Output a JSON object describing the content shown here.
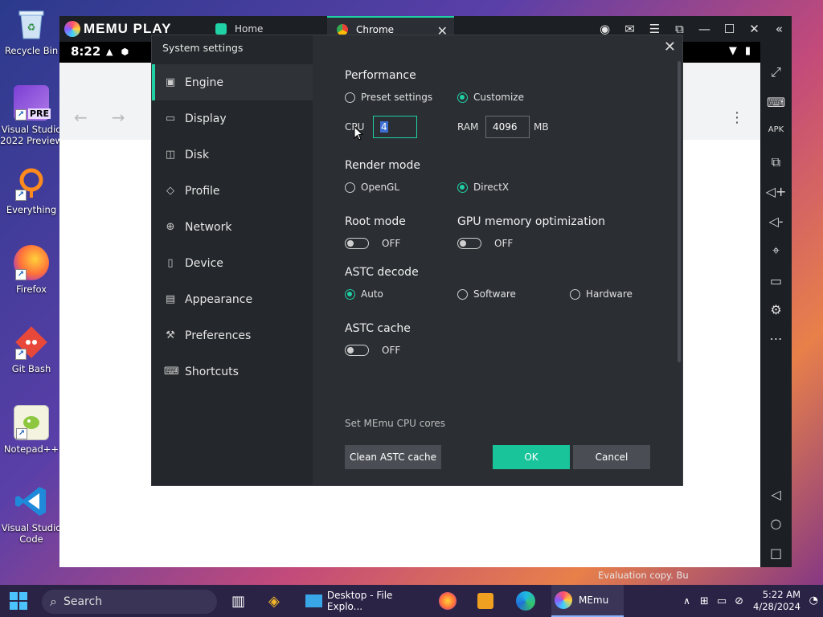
{
  "desktop": {
    "icons": [
      {
        "label": "Recycle Bin",
        "icon": "recycle-bin-icon"
      },
      {
        "label": "Visual Studio 2022 Preview",
        "icon": "visual-studio-preview-icon",
        "badge": "PRE"
      },
      {
        "label": "Everything",
        "icon": "everything-search-icon"
      },
      {
        "label": "Firefox",
        "icon": "firefox-icon"
      },
      {
        "label": "Git Bash",
        "icon": "git-bash-icon"
      },
      {
        "label": "Notepad++",
        "icon": "notepadpp-icon"
      },
      {
        "label": "Visual Studio Code",
        "icon": "vscode-icon"
      }
    ]
  },
  "emulator": {
    "logo_text": "MEMU PLAY",
    "tabs": [
      {
        "label": "Home",
        "active": false
      },
      {
        "label": "Chrome",
        "active": true
      }
    ],
    "android_time": "8:22"
  },
  "dialog": {
    "title": "System settings",
    "nav": [
      {
        "label": "Engine",
        "icon": "chip-icon",
        "active": true
      },
      {
        "label": "Display",
        "icon": "monitor-icon"
      },
      {
        "label": "Disk",
        "icon": "disk-icon"
      },
      {
        "label": "Profile",
        "icon": "tag-icon"
      },
      {
        "label": "Network",
        "icon": "globe-icon"
      },
      {
        "label": "Device",
        "icon": "phone-icon"
      },
      {
        "label": "Appearance",
        "icon": "window-icon"
      },
      {
        "label": "Preferences",
        "icon": "wrench-icon"
      },
      {
        "label": "Shortcuts",
        "icon": "keyboard-icon"
      }
    ],
    "performance": {
      "title": "Performance",
      "preset_label": "Preset settings",
      "customize_label": "Customize",
      "selected": "Customize",
      "cpu_label": "CPU",
      "cpu_value": "4",
      "ram_label": "RAM",
      "ram_value": "4096",
      "ram_unit": "MB"
    },
    "render": {
      "title": "Render mode",
      "opengl_label": "OpenGL",
      "directx_label": "DirectX",
      "selected": "DirectX"
    },
    "root": {
      "title": "Root mode",
      "state": "OFF"
    },
    "gpu": {
      "title": "GPU memory optimization",
      "state": "OFF"
    },
    "astc_decode": {
      "title": "ASTC decode",
      "auto_label": "Auto",
      "software_label": "Software",
      "hardware_label": "Hardware",
      "selected": "Auto"
    },
    "astc_cache": {
      "title": "ASTC cache",
      "state": "OFF"
    },
    "hint": "Set MEmu CPU cores",
    "buttons": {
      "clean_label": "Clean ASTC cache",
      "ok_label": "OK",
      "cancel_label": "Cancel"
    }
  },
  "watermark": "Evaluation copy. Bu",
  "taskbar": {
    "search_label": "Search",
    "explorer_label": "Desktop - File Explo...",
    "memu_label": "MEmu",
    "time": "5:22 AM",
    "date": "4/28/2024"
  },
  "colors": {
    "accent": "#1fd1a5",
    "ok_button": "#19c49b",
    "dialog_bg": "#2b2e33",
    "nav_bg": "#24272b"
  }
}
